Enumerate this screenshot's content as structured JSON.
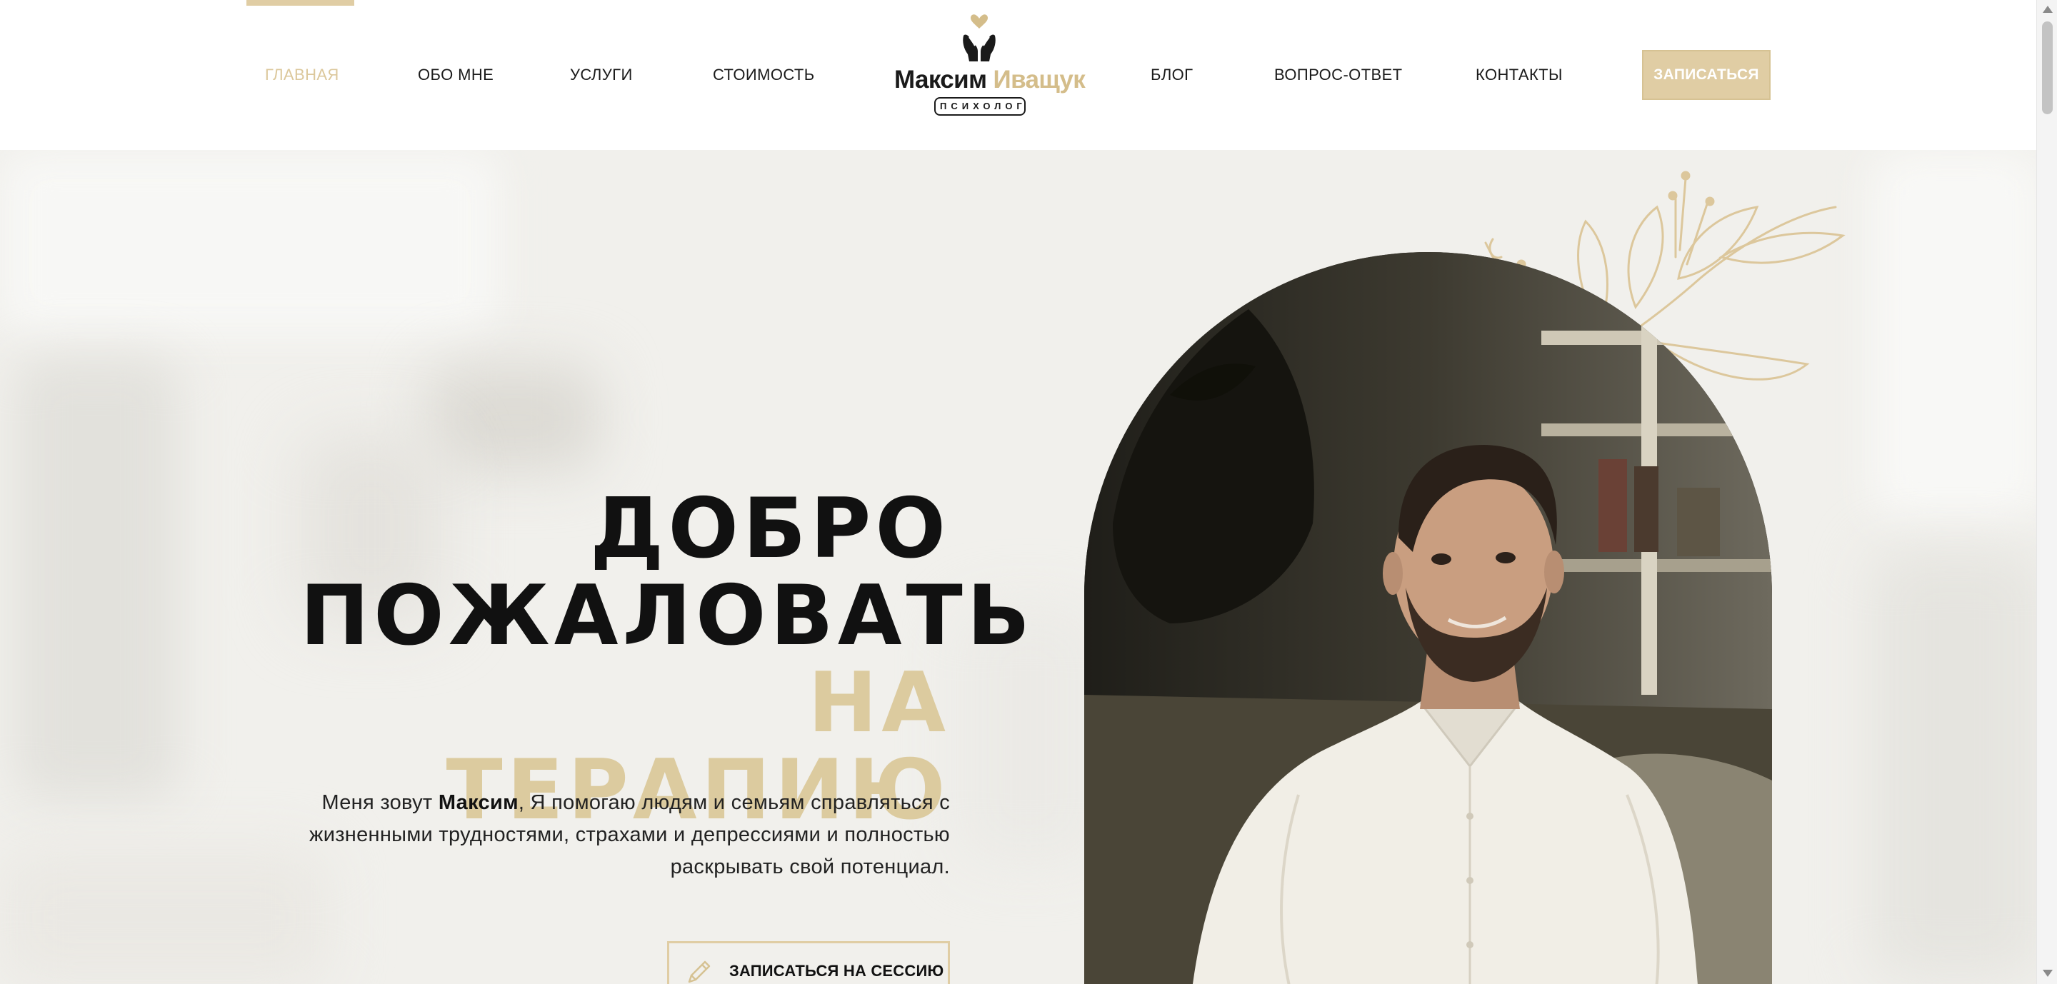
{
  "nav": {
    "items": [
      {
        "label": "Главная",
        "active": true
      },
      {
        "label": "Обо мне",
        "active": false
      },
      {
        "label": "Услуги",
        "active": false
      },
      {
        "label": "Стоимость",
        "active": false
      },
      {
        "label": "Блог",
        "active": false
      },
      {
        "label": "Вопрос-ответ",
        "active": false
      },
      {
        "label": "Контакты",
        "active": false
      }
    ],
    "cta_label": "ЗАПИСАТЬСЯ"
  },
  "logo": {
    "first_name": "Максим",
    "last_name": "Иващук",
    "badge": "ПСИХОЛОГ"
  },
  "hero": {
    "title_line1": "ДОБРО",
    "title_line2": "ПОЖАЛОВАТЬ",
    "title_accent": "НА ТЕРАПИЮ",
    "text_before": "Меня зовут ",
    "text_name": "Максим",
    "text_after": ", Я помогаю людям и семьям справляться с жизненными трудностями, страхами и депрессиями и полностью раскрывать свой потенциал.",
    "session_button": "ЗАПИСАТЬСЯ НА СЕССИЮ"
  },
  "colors": {
    "accent": "#e0cda4",
    "accent_text": "#dccb9f",
    "hero_bg": "#f1f0ec",
    "text": "#111111"
  },
  "icons": {
    "logo": "hands-holding-heart-icon",
    "session_button": "pencil-icon",
    "decoration": "floral-line-art"
  }
}
